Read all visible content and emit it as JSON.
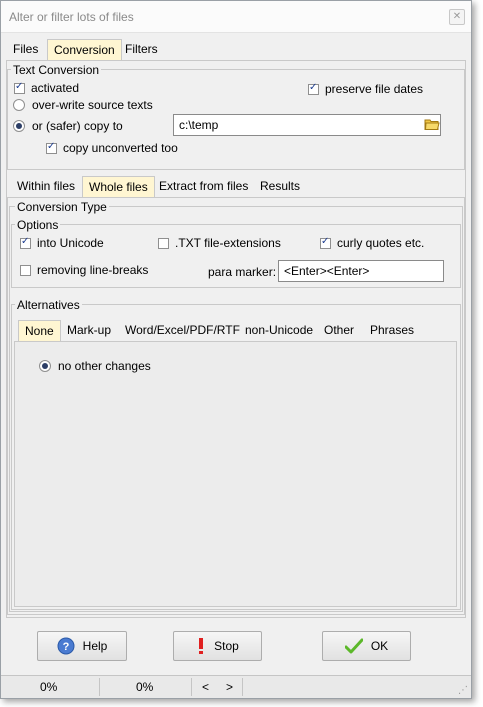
{
  "window": {
    "title": "Alter or filter lots of files",
    "close_glyph": "✕"
  },
  "main_tabs": [
    {
      "label": "Files",
      "active": false
    },
    {
      "label": "Conversion",
      "active": true
    },
    {
      "label": "Filters",
      "active": false
    }
  ],
  "text_conversion": {
    "legend": "Text Conversion",
    "activated": {
      "label": "activated",
      "checked": true
    },
    "preserve_dates": {
      "label": "preserve file dates",
      "checked": true
    },
    "overwrite": {
      "label": "over-write source texts",
      "selected": false
    },
    "copy_to": {
      "label": "or (safer) copy to",
      "selected": true,
      "path": "c:\\temp"
    },
    "copy_unconverted": {
      "label": "copy unconverted too",
      "checked": true
    }
  },
  "sub_tabs": [
    {
      "label": "Within files",
      "active": false
    },
    {
      "label": "Whole files",
      "active": true
    },
    {
      "label": "Extract from files",
      "active": false
    },
    {
      "label": "Results",
      "active": false
    }
  ],
  "conversion_type": {
    "legend": "Conversion Type",
    "options_legend": "Options",
    "into_unicode": {
      "label": "into Unicode",
      "checked": true
    },
    "txt_ext": {
      "label": ".TXT file-extensions",
      "checked": false
    },
    "curly_quotes": {
      "label": "curly quotes etc.",
      "checked": true
    },
    "remove_breaks": {
      "label": "removing line-breaks",
      "checked": false
    },
    "para_marker_label": "para marker:",
    "para_marker_value": "<Enter><Enter>"
  },
  "alternatives": {
    "legend": "Alternatives",
    "tabs": [
      {
        "label": "None",
        "active": true
      },
      {
        "label": "Mark-up",
        "active": false
      },
      {
        "label": "Word/Excel/PDF/RTF",
        "active": false
      },
      {
        "label": "non-Unicode",
        "active": false
      },
      {
        "label": "Other",
        "active": false
      },
      {
        "label": "Phrases",
        "active": false
      }
    ],
    "no_changes": {
      "label": "no other changes",
      "selected": true
    }
  },
  "buttons": {
    "help": {
      "label": "Help",
      "icon": "help-icon"
    },
    "stop": {
      "label": "Stop",
      "icon": "exclamation-icon"
    },
    "ok": {
      "label": "OK",
      "icon": "checkmark-icon"
    }
  },
  "status": {
    "left": "0%",
    "middle": "0%",
    "prev": "<",
    "next": ">"
  },
  "colors": {
    "active_tab": "#fff6d2",
    "help_blue": "#4a7bd1",
    "stop_red": "#e02020",
    "ok_green": "#5cb82a"
  }
}
